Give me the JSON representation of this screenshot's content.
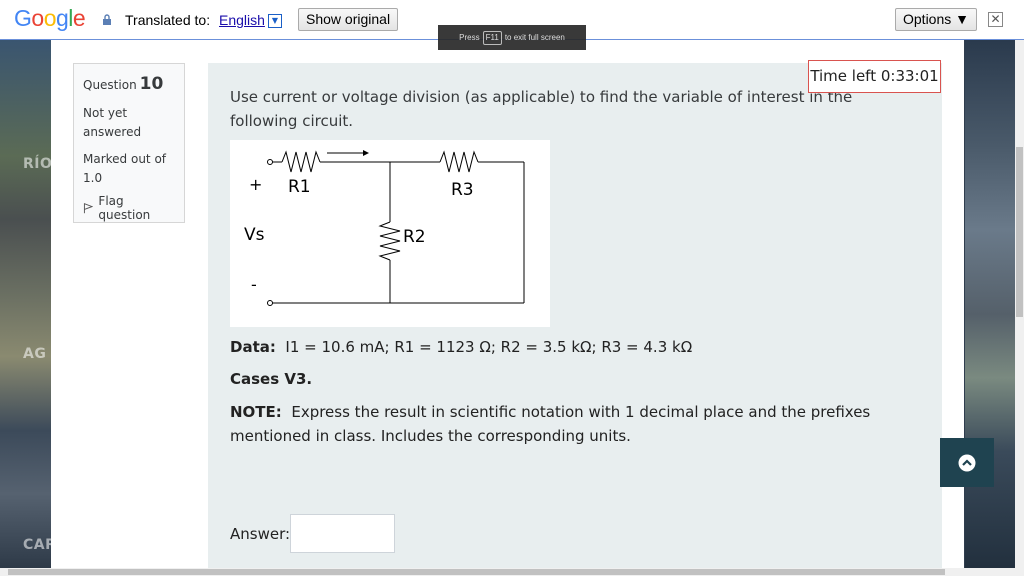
{
  "translate_bar": {
    "logo": "Google",
    "translated_to_label": "Translated to:",
    "language": "English",
    "show_original": "Show original",
    "options": "Options ▼",
    "close": "✕"
  },
  "fullscreen_notice": {
    "prefix": "Press",
    "key": "F11",
    "suffix": "to exit full screen"
  },
  "background_words": [
    "RÍO",
    "AG",
    "CAR"
  ],
  "question_info": {
    "label": "Question",
    "number": "10",
    "status_line1": "Not yet",
    "status_line2": "answered",
    "marks_line1": "Marked out of",
    "marks_line2": "1.0",
    "flag": "Flag question"
  },
  "timer": "Time left 0:33:01",
  "question": {
    "text": "Use current or voltage division (as applicable) to find the variable of interest in the following circuit.",
    "circuit": {
      "plus": "+",
      "minus": "-",
      "source": "Vs",
      "r1": "R1",
      "r2": "R2",
      "r3": "R3"
    },
    "data_label": "Data:",
    "data_value": "I1 = 10.6 mA; R1 = 1123 Ω; R2 = 3.5 kΩ; R3 = 4.3 kΩ",
    "cases": "Cases V3.",
    "note_label": "NOTE:",
    "note_text": "Express the result in scientific notation with 1 decimal place and the prefixes mentioned in class. Includes the corresponding units.",
    "answer_label": "Answer:",
    "answer_value": ""
  },
  "colors": {
    "accent": "#1f4350",
    "timer_border": "#d9534f",
    "content_bg": "#e8eeef"
  },
  "icons": {
    "lock": "lock-icon",
    "flag": "flag-icon",
    "back_to_top": "chevron-up-icon"
  }
}
